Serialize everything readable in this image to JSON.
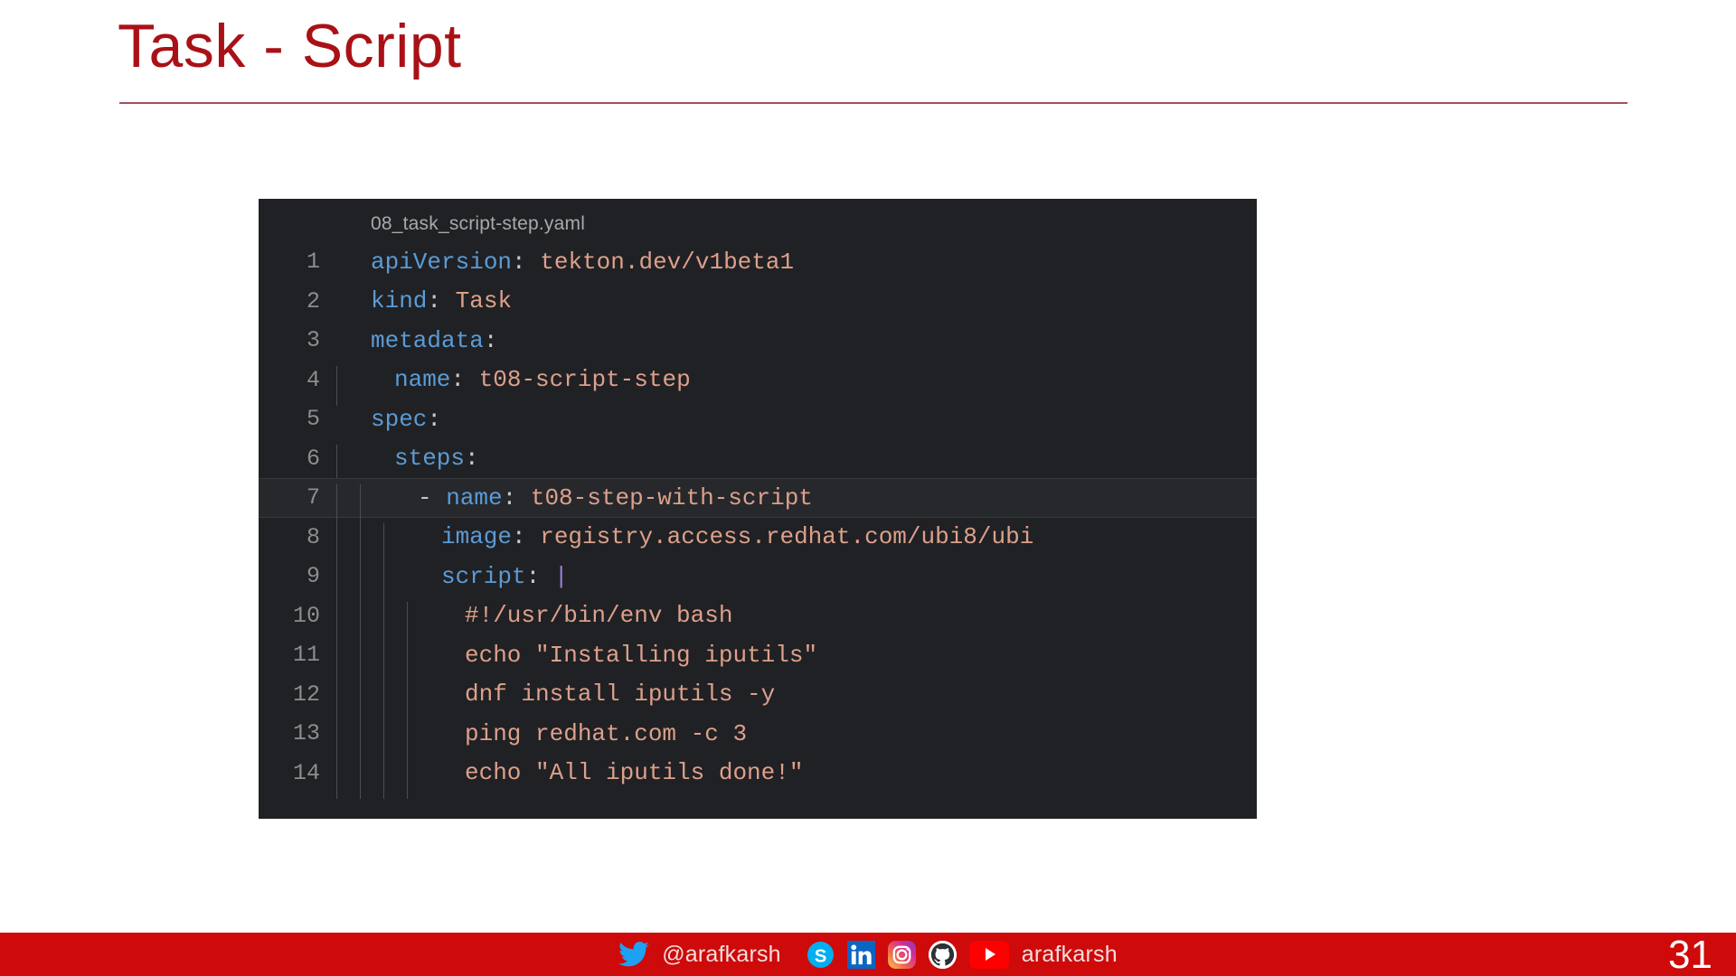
{
  "slide": {
    "title": "Task - Script",
    "page_number": "31",
    "accent_color": "#A91117",
    "footer_color": "#CE0A0A"
  },
  "code_block": {
    "filename": "08_task_script-step.yaml",
    "background": "#202124",
    "active_line": 7,
    "key_color": "#5b9bd5",
    "value_color": "#dda08b",
    "lines": [
      {
        "num": "1",
        "key": "apiVersion",
        "colon": ":",
        "value": " tekton.dev/v1beta1",
        "indent": 0
      },
      {
        "num": "2",
        "key": "kind",
        "colon": ":",
        "value": " Task",
        "indent": 0
      },
      {
        "num": "3",
        "key": "metadata",
        "colon": ":",
        "value": "",
        "indent": 0
      },
      {
        "num": "4",
        "key": "name",
        "colon": ":",
        "value": " t08-script-step",
        "indent": 1
      },
      {
        "num": "5",
        "key": "spec",
        "colon": ":",
        "value": "",
        "indent": 0
      },
      {
        "num": "6",
        "key": "steps",
        "colon": ":",
        "value": "",
        "indent": 1
      },
      {
        "num": "7",
        "key": "name",
        "colon": ":",
        "value": " t08-step-with-script",
        "indent": 2,
        "dash": "- "
      },
      {
        "num": "8",
        "key": "image",
        "colon": ":",
        "value": " registry.access.redhat.com/ubi8/ubi",
        "indent": 3
      },
      {
        "num": "9",
        "key": "script",
        "colon": ":",
        "value": "",
        "indent": 3,
        "pipe": " |"
      },
      {
        "num": "10",
        "key": "",
        "colon": "",
        "value": "#!/usr/bin/env bash",
        "indent": 4
      },
      {
        "num": "11",
        "key": "",
        "colon": "",
        "value": "echo \"Installing iputils\"",
        "indent": 4
      },
      {
        "num": "12",
        "key": "",
        "colon": "",
        "value": "dnf install iputils -y",
        "indent": 4
      },
      {
        "num": "13",
        "key": "",
        "colon": "",
        "value": "ping redhat.com -c 3",
        "indent": 4
      },
      {
        "num": "14",
        "key": "",
        "colon": "",
        "value": "echo \"All iputils done!\"",
        "indent": 4
      }
    ]
  },
  "footer": {
    "twitter_handle": "@arafkarsh",
    "youtube_label": "arafkarsh",
    "icons": [
      "twitter-icon",
      "skype-icon",
      "linkedin-icon",
      "instagram-icon",
      "github-icon",
      "youtube-icon"
    ]
  }
}
